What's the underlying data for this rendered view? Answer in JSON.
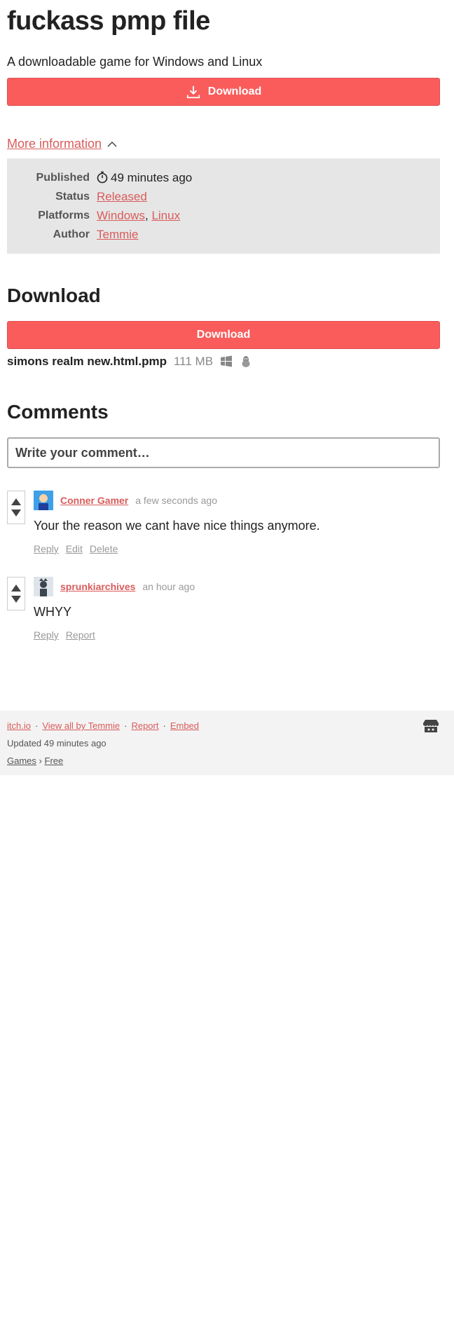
{
  "game": {
    "title": "fuckass pmp file",
    "tagline": "A downloadable game for Windows and Linux"
  },
  "download_button": {
    "label": "Download",
    "icon": "download-icon"
  },
  "more_info": {
    "toggle_label": "More information",
    "rows": {
      "published_label": "Published",
      "published_value": "49 minutes ago",
      "status_label": "Status",
      "status_value": "Released",
      "platforms_label": "Platforms",
      "platform_1": "Windows",
      "platform_sep": ",",
      "platform_2": "Linux",
      "author_label": "Author",
      "author_value": "Temmie"
    }
  },
  "download_section": {
    "heading": "Download",
    "button_label": "Download",
    "file_name": "simons realm new.html.pmp",
    "file_size": "111 MB"
  },
  "comments": {
    "heading": "Comments",
    "placeholder": "Write your comment…",
    "items": [
      {
        "author": "Conner Gamer",
        "time": "a few seconds ago",
        "text": "Your the reason we cant have nice things anymore.",
        "actions": [
          "Reply",
          "Edit",
          "Delete"
        ]
      },
      {
        "author": "sprunkiarchives",
        "time": "an hour ago",
        "text": "WHYY",
        "actions": [
          "Reply",
          "Report"
        ]
      }
    ]
  },
  "footer": {
    "links": [
      "itch.io",
      "View all by Temmie",
      "Report",
      "Embed"
    ],
    "separator": "·",
    "updated": "Updated 49 minutes ago",
    "crumb_1": "Games",
    "crumb_sep": "›",
    "crumb_2": "Free"
  },
  "colors": {
    "accent": "#fa5c5c",
    "link": "#da5b5b",
    "panel_bg": "#e6e6e6",
    "footer_bg": "#f3f3f3"
  }
}
